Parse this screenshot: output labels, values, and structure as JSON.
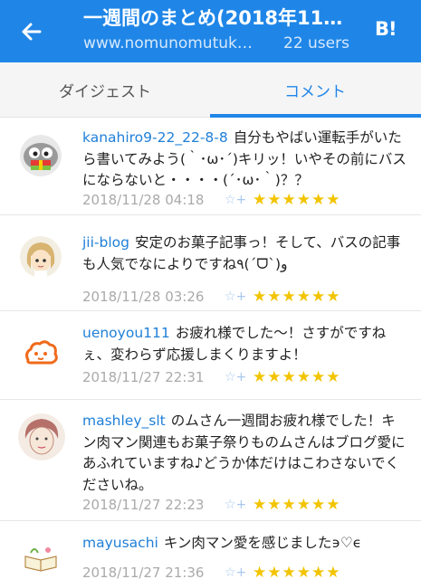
{
  "header": {
    "title": "一週間のまとめ(2018年11…",
    "url": "www.nomunomutuk…",
    "users": "22 users",
    "logo": "B!"
  },
  "tabs": [
    {
      "label": "ダイジェスト",
      "active": false
    },
    {
      "label": "コメント",
      "active": true
    }
  ],
  "comments": [
    {
      "user": "kanahiro9-22_22-8-8",
      "text": "自分もやばい運転手がいたら書いてみよう(｀･ω･´)キリッ！いやその前にバスにならないと・・・・(´･ω･｀)？？",
      "date": "2018/11/28 04:18",
      "stars": "★★★★★★",
      "avatar": "green-robot-avatar"
    },
    {
      "user": "jii-blog",
      "text": "安定のお菓子記事っ！そして、バスの記事も人気でなによりですね٩(ˊᗜˋ)و",
      "date": "2018/11/28 03:26",
      "stars": "★★★★★★",
      "avatar": "anime-girl-avatar"
    },
    {
      "user": "uenoyou111",
      "text": "お疲れ様でした～！さすがですねぇ、変わらず応援しまくりますよ！",
      "date": "2018/11/27 22:31",
      "stars": "★★★★★★",
      "avatar": "orange-cloud-avatar"
    },
    {
      "user": "mashley_slt",
      "text": "のムさん一週間お疲れ様でした！キン肉マン関連もお菓子祭りものムさんはブログ愛にあふれていますね♪どうか体だけはこわさないでくださいね。",
      "date": "2018/11/27 22:23",
      "stars": "★★★★★★",
      "avatar": "sketch-face-avatar"
    },
    {
      "user": "mayusachi",
      "text": "キン肉マン愛を感じました϶♡ϵ",
      "date": "2018/11/27 21:36",
      "stars": "★★★★★★",
      "avatar": "book-avatar"
    }
  ],
  "add_star_label": "☆+",
  "colors": {
    "header_bg": "#1f86e8",
    "accent": "#1f86e8",
    "star": "#f2c400"
  }
}
